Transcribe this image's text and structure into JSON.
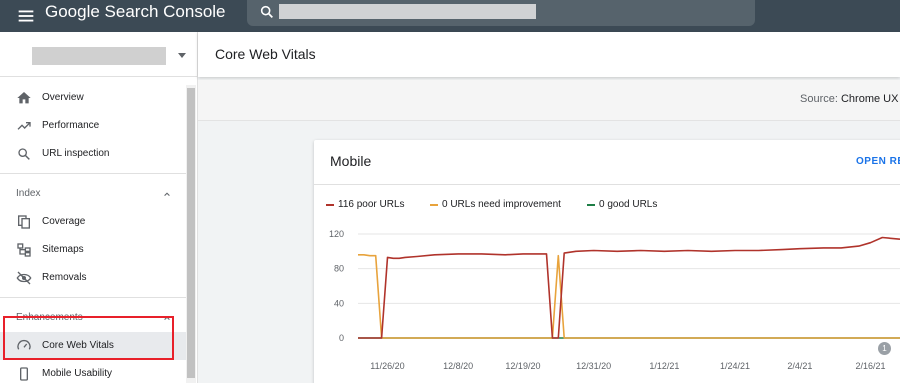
{
  "app": {
    "title": "Google Search Console"
  },
  "search": {
    "value": ""
  },
  "property": {
    "name": ""
  },
  "sidebar": {
    "items": [
      {
        "label": "Overview",
        "icon": "home-icon"
      },
      {
        "label": "Performance",
        "icon": "trending-up-icon"
      },
      {
        "label": "URL inspection",
        "icon": "search-icon"
      }
    ],
    "index": {
      "header": "Index",
      "items": [
        {
          "label": "Coverage",
          "icon": "file-copy-icon"
        },
        {
          "label": "Sitemaps",
          "icon": "sitemap-icon"
        },
        {
          "label": "Removals",
          "icon": "eye-off-icon"
        }
      ]
    },
    "enhancements": {
      "header": "Enhancements",
      "items": [
        {
          "label": "Core Web Vitals",
          "icon": "speed-gauge-icon",
          "active": true
        },
        {
          "label": "Mobile Usability",
          "icon": "smartphone-icon"
        }
      ]
    }
  },
  "main": {
    "title": "Core Web Vitals",
    "source_label": "Source:",
    "source_value": "Chrome UX re"
  },
  "card": {
    "title": "Mobile",
    "open_report": "OPEN RE",
    "annotation_count": "1",
    "legend": [
      {
        "label": "116 poor URLs",
        "color": "#b0332b"
      },
      {
        "label": "0 URLs need improvement",
        "color": "#e8a33c"
      },
      {
        "label": "0 good URLs",
        "color": "#1e7e46"
      }
    ]
  },
  "colors": {
    "accent": "#1a73e8",
    "topbar": "#3c4a55",
    "highlight": "#e8202a"
  },
  "chart_data": {
    "type": "line",
    "y_ticks": [
      "120",
      "80",
      "40",
      "0"
    ],
    "ylim": [
      0,
      120
    ],
    "x_tick_labels": [
      "11/26/20",
      "12/8/20",
      "12/19/20",
      "12/31/20",
      "1/12/21",
      "1/24/21",
      "2/4/21",
      "2/16/21"
    ],
    "x": [
      "11/21/20",
      "11/22/20",
      "11/23/20",
      "11/24/20",
      "11/25/20",
      "11/26/20",
      "11/27/20",
      "11/28/20",
      "11/29/20",
      "12/1/20",
      "12/4/20",
      "12/8/20",
      "12/12/20",
      "12/16/20",
      "12/19/20",
      "12/22/20",
      "12/23/20",
      "12/24/20",
      "12/25/20",
      "12/26/20",
      "12/27/20",
      "12/28/20",
      "12/31/20",
      "1/4/21",
      "1/8/21",
      "1/12/21",
      "1/16/21",
      "1/20/21",
      "1/24/21",
      "1/28/21",
      "2/1/21",
      "2/4/21",
      "2/8/21",
      "2/11/21",
      "2/14/21",
      "2/16/21",
      "2/18/21",
      "2/21/21"
    ],
    "series": [
      {
        "name": "116 poor URLs",
        "color": "#b0332b",
        "values": [
          0,
          0,
          0,
          0,
          0,
          93,
          92,
          92,
          93,
          94,
          96,
          97,
          97,
          96,
          97,
          97,
          97,
          0,
          0,
          98,
          99,
          100,
          101,
          100,
          101,
          100,
          101,
          100,
          101,
          101,
          102,
          103,
          104,
          104,
          106,
          110,
          116,
          114
        ]
      },
      {
        "name": "0 URLs need improvement",
        "color": "#e8a33c",
        "values": [
          96,
          96,
          95,
          95,
          0,
          0,
          0,
          0,
          0,
          0,
          0,
          0,
          0,
          0,
          0,
          0,
          0,
          0,
          95,
          0,
          0,
          0,
          0,
          0,
          0,
          0,
          0,
          0,
          0,
          0,
          0,
          0,
          0,
          0,
          0,
          0,
          0,
          0
        ]
      },
      {
        "name": "0 good URLs",
        "color": "#1e7e46",
        "values": [
          0,
          0,
          0,
          0,
          0,
          0,
          0,
          0,
          0,
          0,
          0,
          0,
          0,
          0,
          0,
          0,
          0,
          0,
          0,
          0,
          0,
          0,
          0,
          0,
          0,
          0,
          0,
          0,
          0,
          0,
          0,
          0,
          0,
          0,
          0,
          0,
          0,
          0
        ]
      }
    ]
  }
}
